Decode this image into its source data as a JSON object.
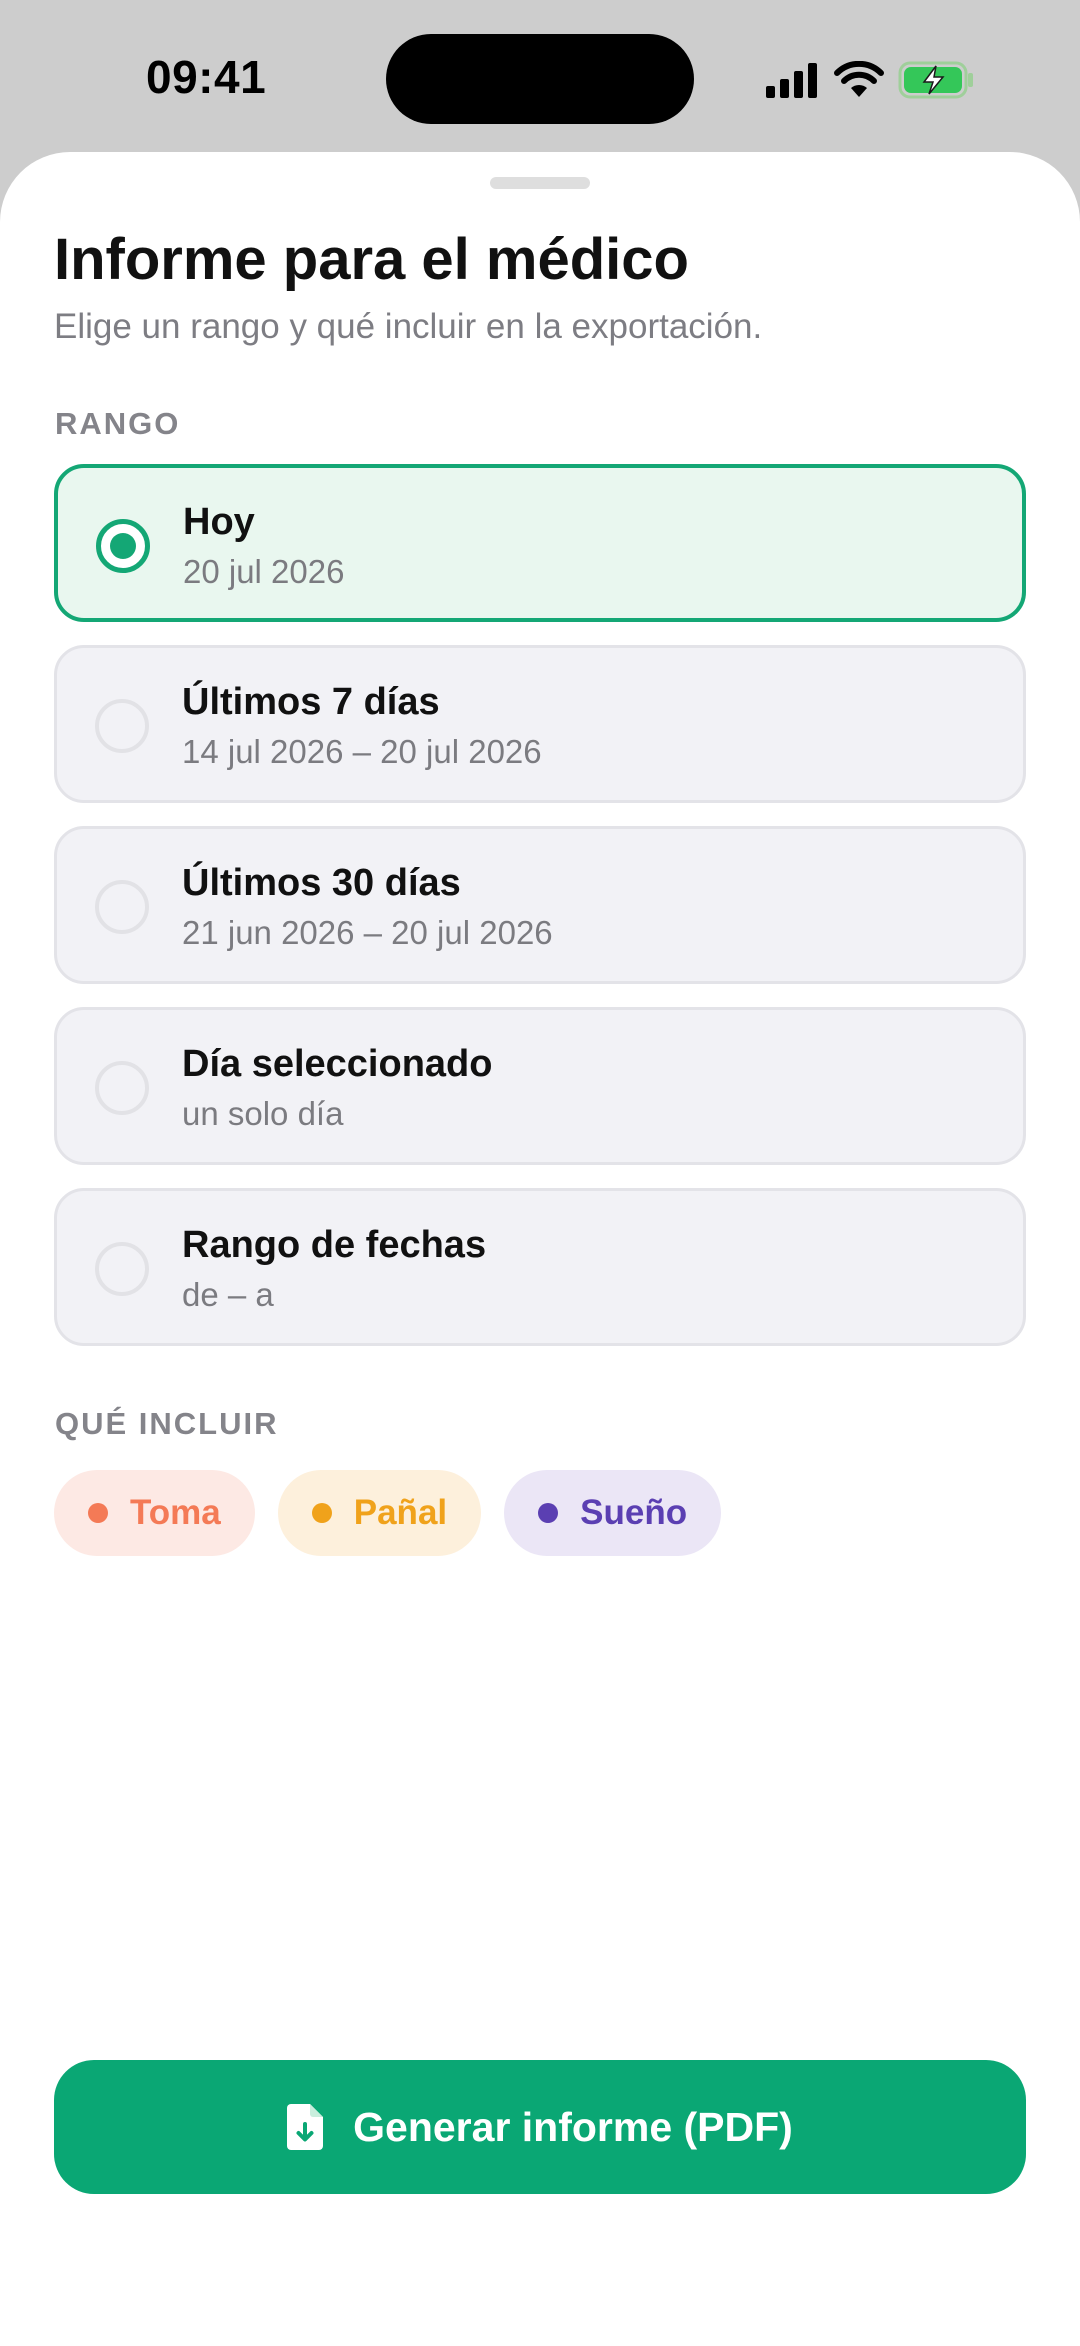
{
  "status_bar": {
    "time": "09:41"
  },
  "sheet": {
    "title": "Informe para el médico",
    "subtitle": "Elige un rango y qué incluir en la exportación."
  },
  "range_section": {
    "label": "RANGO",
    "options": [
      {
        "title": "Hoy",
        "subtitle": "20 jul 2026",
        "selected": true
      },
      {
        "title": "Últimos 7 días",
        "subtitle": "14 jul 2026 – 20 jul 2026",
        "selected": false
      },
      {
        "title": "Últimos 30 días",
        "subtitle": "21 jun 2026 – 20 jul 2026",
        "selected": false
      },
      {
        "title": "Día seleccionado",
        "subtitle": "un solo día",
        "selected": false
      },
      {
        "title": "Rango de fechas",
        "subtitle": "de – a",
        "selected": false
      }
    ]
  },
  "include_section": {
    "label": "QUÉ INCLUIR",
    "chips": [
      {
        "label": "Toma",
        "color": "#f47a56",
        "bg": "#fde9e4"
      },
      {
        "label": "Pañal",
        "color": "#f0a21b",
        "bg": "#fdf0dc"
      },
      {
        "label": "Sueño",
        "color": "#5b3fb2",
        "bg": "#ebe6f6"
      }
    ]
  },
  "cta": {
    "label": "Generar informe (PDF)",
    "icon": "document-download-icon"
  },
  "colors": {
    "accent": "#0aa774",
    "selected_bg": "#e9f7ef"
  }
}
